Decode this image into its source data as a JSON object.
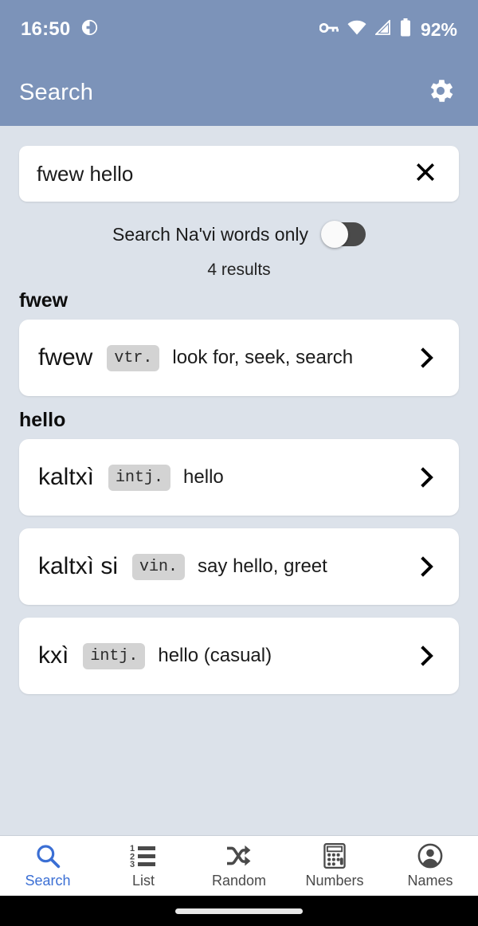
{
  "status_bar": {
    "time": "16:50",
    "battery_percent": "92%",
    "icons": [
      "do-not-disturb-icon",
      "vpn-key-icon",
      "wifi-icon",
      "cellular-signal-icon",
      "battery-icon"
    ]
  },
  "app_bar": {
    "title": "Search",
    "settings_icon": "gear-icon"
  },
  "search": {
    "value": "fwew hello",
    "placeholder": "Search",
    "clear_icon": "close-x-icon"
  },
  "filter": {
    "label": "Search Na'vi words only",
    "enabled": false
  },
  "results_summary": "4 results",
  "groups": [
    {
      "heading": "fwew",
      "entries": [
        {
          "navi": "fwew",
          "pos": "vtr.",
          "definition": "look for, seek, search",
          "chevron": "chevron-right-icon"
        }
      ]
    },
    {
      "heading": "hello",
      "entries": [
        {
          "navi": "kaltxì",
          "pos": "intj.",
          "definition": "hello",
          "chevron": "chevron-right-icon"
        },
        {
          "navi": "kaltxì si",
          "pos": "vin.",
          "definition": "say hello, greet",
          "chevron": "chevron-right-icon"
        },
        {
          "navi": "kxì",
          "pos": "intj.",
          "definition": "hello (casual)",
          "chevron": "chevron-right-icon"
        }
      ]
    }
  ],
  "bottom_nav": {
    "active_index": 0,
    "items": [
      {
        "label": "Search",
        "icon": "search-icon"
      },
      {
        "label": "List",
        "icon": "numbered-list-icon"
      },
      {
        "label": "Random",
        "icon": "shuffle-icon"
      },
      {
        "label": "Numbers",
        "icon": "calculator-icon"
      },
      {
        "label": "Names",
        "icon": "person-circle-icon"
      }
    ]
  },
  "colors": {
    "app_bar": "#7c93b9",
    "page_background": "#dce2ea",
    "card": "#ffffff",
    "badge": "#d3d3d3",
    "accent": "#3b6fd4",
    "switch_track": "#4a4a4a"
  }
}
